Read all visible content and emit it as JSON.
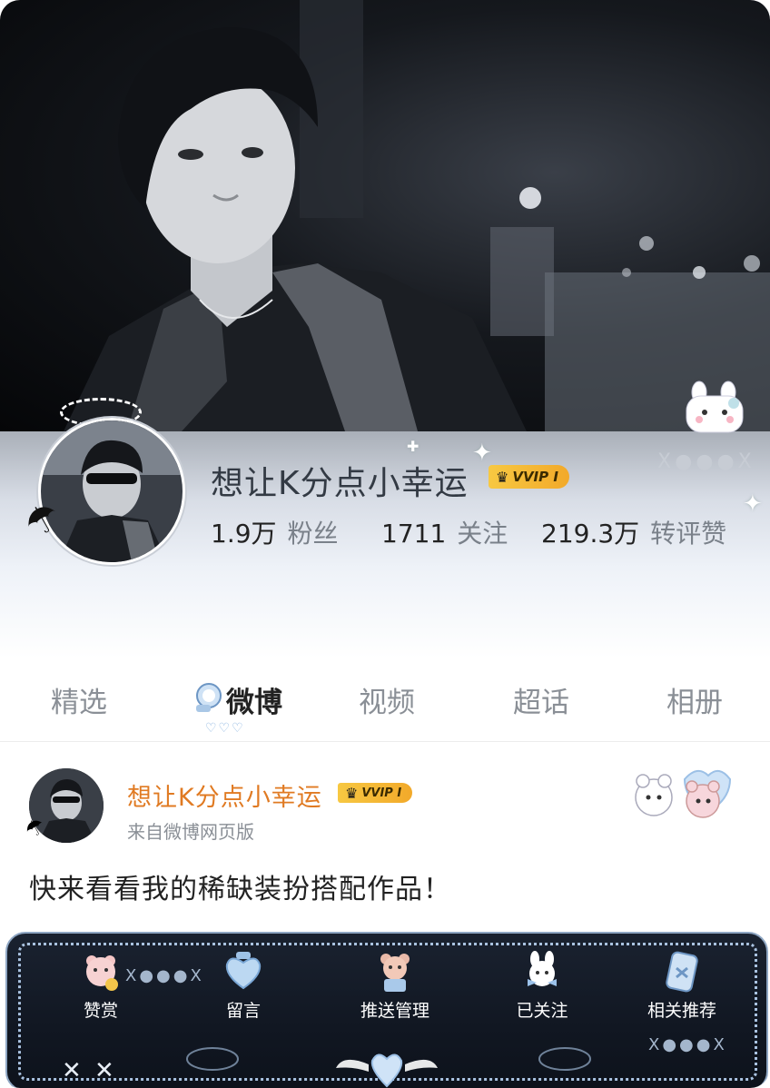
{
  "profile": {
    "name": "想让K分点小幸运",
    "vip_badge": "VVIP I",
    "stats": [
      {
        "value": "1.9万",
        "label": "粉丝"
      },
      {
        "value": "1711",
        "label": "关注"
      },
      {
        "value": "219.3万",
        "label": "转评赞"
      }
    ]
  },
  "tabs": [
    {
      "label": "精选",
      "active": false
    },
    {
      "label": "微博",
      "active": true
    },
    {
      "label": "视频",
      "active": false
    },
    {
      "label": "超话",
      "active": false
    },
    {
      "label": "相册",
      "active": false
    }
  ],
  "post": {
    "author": "想让K分点小幸运",
    "vip_badge": "VVIP I",
    "source": "来自微博网页版",
    "text": "快来看看我的稀缺装扮搭配作品！"
  },
  "actions": [
    {
      "label": "赞赏",
      "icon": "bear-coin-icon"
    },
    {
      "label": "留言",
      "icon": "heart-icon"
    },
    {
      "label": "推送管理",
      "icon": "bear-box-icon"
    },
    {
      "label": "已关注",
      "icon": "bunny-bow-icon"
    },
    {
      "label": "相关推荐",
      "icon": "card-icon"
    }
  ],
  "colors": {
    "accent_orange": "#e07a22",
    "vip_gold": "#f2b233",
    "text_primary": "#222222",
    "text_secondary": "#8a8f96",
    "card_bg": "#111722"
  }
}
